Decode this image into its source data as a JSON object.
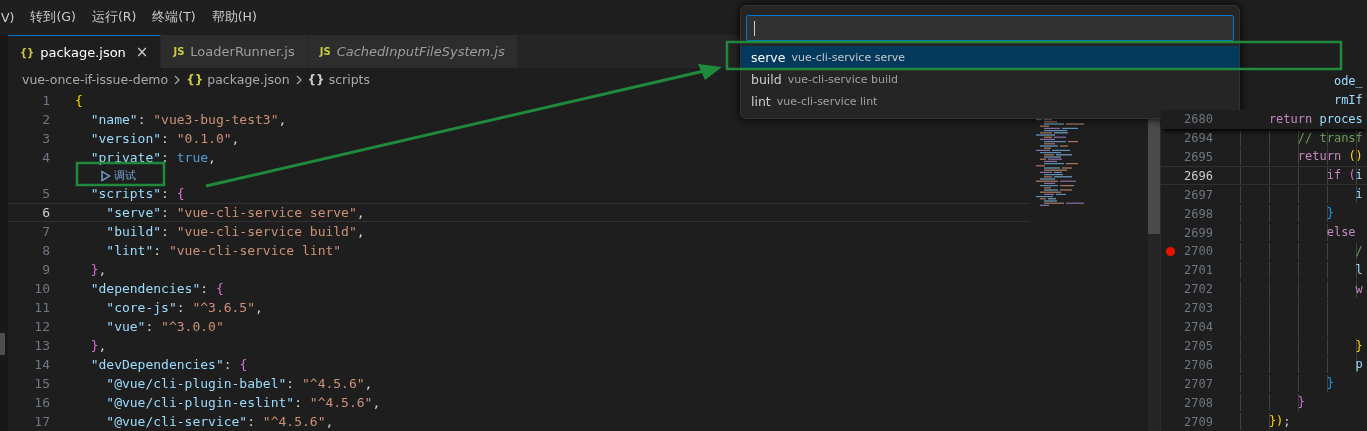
{
  "menu": [
    "V)",
    "转到(G)",
    "运行(R)",
    "终端(T)",
    "帮助(H)"
  ],
  "tabs": [
    {
      "icon": "{}",
      "label": "package.json",
      "selected": true,
      "preview": false,
      "close": "×"
    },
    {
      "icon": "JS",
      "label": "LoaderRunner.js",
      "selected": false,
      "preview": false
    },
    {
      "icon": "JS",
      "label": "CachedInputFileSystem.js",
      "selected": false,
      "preview": true
    }
  ],
  "breadcrumbs": [
    {
      "kind": "folder",
      "text": "vue-once-if-issue-demo"
    },
    {
      "kind": "file",
      "icon": "{}",
      "text": "package.json"
    },
    {
      "kind": "symbol",
      "icon": "{}",
      "text": "scripts"
    }
  ],
  "editor": {
    "lines": [
      {
        "kind": "code",
        "number": "1",
        "current": false,
        "tokens": [
          {
            "kind": "b1",
            "text": "{"
          }
        ]
      },
      {
        "kind": "code",
        "number": "2",
        "current": false,
        "tokens": [
          {
            "kind": "key",
            "text": "  \"name\""
          },
          {
            "kind": "p",
            "text": ": "
          },
          {
            "kind": "str",
            "text": "\"vue3-bug-test3\""
          },
          {
            "kind": "p",
            "text": ","
          }
        ]
      },
      {
        "kind": "code",
        "number": "3",
        "current": false,
        "tokens": [
          {
            "kind": "key",
            "text": "  \"version\""
          },
          {
            "kind": "p",
            "text": ": "
          },
          {
            "kind": "str",
            "text": "\"0.1.0\""
          },
          {
            "kind": "p",
            "text": ","
          }
        ]
      },
      {
        "kind": "code",
        "number": "4",
        "current": false,
        "tokens": [
          {
            "kind": "key",
            "text": "  \"private\""
          },
          {
            "kind": "p",
            "text": ": "
          },
          {
            "kind": "kw",
            "text": "true"
          },
          {
            "kind": "p",
            "text": ","
          }
        ]
      },
      {
        "kind": "codelens",
        "text": "调试"
      },
      {
        "kind": "code",
        "number": "5",
        "current": false,
        "tokens": [
          {
            "kind": "key",
            "text": "  \"scripts\""
          },
          {
            "kind": "p",
            "text": ": "
          },
          {
            "kind": "b2",
            "text": "{"
          }
        ]
      },
      {
        "kind": "code",
        "number": "6",
        "current": true,
        "tokens": [
          {
            "kind": "key",
            "text": "    \"serve\""
          },
          {
            "kind": "p",
            "text": ": "
          },
          {
            "kind": "str",
            "text": "\"vue-cli-service serve\""
          },
          {
            "kind": "p",
            "text": ","
          }
        ]
      },
      {
        "kind": "code",
        "number": "7",
        "current": false,
        "tokens": [
          {
            "kind": "key",
            "text": "    \"build\""
          },
          {
            "kind": "p",
            "text": ": "
          },
          {
            "kind": "str",
            "text": "\"vue-cli-service build\""
          },
          {
            "kind": "p",
            "text": ","
          }
        ]
      },
      {
        "kind": "code",
        "number": "8",
        "current": false,
        "tokens": [
          {
            "kind": "key",
            "text": "    \"lint\""
          },
          {
            "kind": "p",
            "text": ": "
          },
          {
            "kind": "str",
            "text": "\"vue-cli-service lint\""
          }
        ]
      },
      {
        "kind": "code",
        "number": "9",
        "current": false,
        "tokens": [
          {
            "kind": "b2",
            "text": "  }"
          },
          {
            "kind": "p",
            "text": ","
          }
        ]
      },
      {
        "kind": "code",
        "number": "10",
        "current": false,
        "tokens": [
          {
            "kind": "key",
            "text": "  \"dependencies\""
          },
          {
            "kind": "p",
            "text": ": "
          },
          {
            "kind": "b2",
            "text": "{"
          }
        ]
      },
      {
        "kind": "code",
        "number": "11",
        "current": false,
        "tokens": [
          {
            "kind": "key",
            "text": "    \"core-js\""
          },
          {
            "kind": "p",
            "text": ": "
          },
          {
            "kind": "str",
            "text": "\"^3.6.5\""
          },
          {
            "kind": "p",
            "text": ","
          }
        ]
      },
      {
        "kind": "code",
        "number": "12",
        "current": false,
        "tokens": [
          {
            "kind": "key",
            "text": "    \"vue\""
          },
          {
            "kind": "p",
            "text": ": "
          },
          {
            "kind": "str",
            "text": "\"^3.0.0\""
          }
        ]
      },
      {
        "kind": "code",
        "number": "13",
        "current": false,
        "tokens": [
          {
            "kind": "b2",
            "text": "  }"
          },
          {
            "kind": "p",
            "text": ","
          }
        ]
      },
      {
        "kind": "code",
        "number": "14",
        "current": false,
        "tokens": [
          {
            "kind": "key",
            "text": "  \"devDependencies\""
          },
          {
            "kind": "p",
            "text": ": "
          },
          {
            "kind": "b2",
            "text": "{"
          }
        ]
      },
      {
        "kind": "code",
        "number": "15",
        "current": false,
        "tokens": [
          {
            "kind": "key",
            "text": "    \"@vue/cli-plugin-babel\""
          },
          {
            "kind": "p",
            "text": ": "
          },
          {
            "kind": "str",
            "text": "\"^4.5.6\""
          },
          {
            "kind": "p",
            "text": ","
          }
        ]
      },
      {
        "kind": "code",
        "number": "16",
        "current": false,
        "tokens": [
          {
            "kind": "key",
            "text": "    \"@vue/cli-plugin-eslint\""
          },
          {
            "kind": "p",
            "text": ": "
          },
          {
            "kind": "str",
            "text": "\"^4.5.6\""
          },
          {
            "kind": "p",
            "text": ","
          }
        ]
      },
      {
        "kind": "code",
        "number": "17",
        "current": false,
        "tokens": [
          {
            "kind": "key",
            "text": "    \"@vue/cli-service\""
          },
          {
            "kind": "p",
            "text": ": "
          },
          {
            "kind": "str",
            "text": "\"^4.5.6\""
          },
          {
            "kind": "p",
            "text": ","
          }
        ]
      }
    ]
  },
  "side_editor": {
    "lines": [
      {
        "sticky": true,
        "current": false,
        "tokens": [
          {
            "kind": "ident",
            "text": "             ode_"
          }
        ]
      },
      {
        "sticky": true,
        "current": false,
        "tokens": [
          {
            "kind": "ident",
            "text": "             rmIf"
          }
        ]
      },
      {
        "number": "2680",
        "sticky": true,
        "current": false,
        "breakpoint": false,
        "tokens": [
          {
            "kind": "ctl",
            "text": "    return"
          },
          {
            "kind": "ident",
            "text": " proces"
          }
        ]
      },
      {
        "number": "2694",
        "sticky": false,
        "current": false,
        "breakpoint": false,
        "tokens": [
          {
            "kind": "comment",
            "text": "        // transf"
          }
        ]
      },
      {
        "number": "2695",
        "sticky": false,
        "current": false,
        "breakpoint": false,
        "tokens": [
          {
            "kind": "ctl",
            "text": "        return"
          },
          {
            "kind": "b1",
            "text": " ()"
          }
        ]
      },
      {
        "number": "2696",
        "sticky": false,
        "current": true,
        "breakpoint": false,
        "tokens": [
          {
            "kind": "ctl",
            "text": "            if"
          },
          {
            "kind": "b2",
            "text": " ("
          },
          {
            "kind": "ident",
            "text": "i"
          }
        ]
      },
      {
        "number": "2697",
        "sticky": false,
        "current": false,
        "breakpoint": false,
        "tokens": [
          {
            "kind": "ident",
            "text": "                i"
          }
        ]
      },
      {
        "number": "2698",
        "sticky": false,
        "current": false,
        "breakpoint": false,
        "tokens": [
          {
            "kind": "b3",
            "text": "            }"
          }
        ]
      },
      {
        "number": "2699",
        "sticky": false,
        "current": false,
        "breakpoint": false,
        "tokens": [
          {
            "kind": "ctl",
            "text": "            else"
          }
        ]
      },
      {
        "number": "2700",
        "sticky": false,
        "current": false,
        "breakpoint": true,
        "tokens": [
          {
            "kind": "comment",
            "text": "                /"
          }
        ]
      },
      {
        "number": "2701",
        "sticky": false,
        "current": false,
        "breakpoint": false,
        "tokens": [
          {
            "kind": "ident",
            "text": "                l"
          }
        ]
      },
      {
        "number": "2702",
        "sticky": false,
        "current": false,
        "breakpoint": false,
        "tokens": [
          {
            "kind": "ctl",
            "text": "                w"
          }
        ]
      },
      {
        "number": "2703",
        "sticky": false,
        "current": false,
        "breakpoint": false
      },
      {
        "number": "2704",
        "sticky": false,
        "current": false,
        "breakpoint": false
      },
      {
        "number": "2705",
        "sticky": false,
        "current": false,
        "breakpoint": false,
        "tokens": [
          {
            "kind": "b1",
            "text": "                }"
          }
        ]
      },
      {
        "number": "2706",
        "sticky": false,
        "current": false,
        "breakpoint": false,
        "tokens": [
          {
            "kind": "ident",
            "text": "                p"
          }
        ]
      },
      {
        "number": "2707",
        "sticky": false,
        "current": false,
        "breakpoint": false,
        "tokens": [
          {
            "kind": "b3",
            "text": "            }"
          }
        ]
      },
      {
        "number": "2708",
        "sticky": false,
        "current": false,
        "breakpoint": false,
        "tokens": [
          {
            "kind": "b2",
            "text": "        }"
          }
        ]
      },
      {
        "number": "2709",
        "sticky": false,
        "current": false,
        "breakpoint": false,
        "tokens": [
          {
            "kind": "b1",
            "text": "    })"
          },
          {
            "kind": "p",
            "text": ";"
          }
        ]
      }
    ]
  },
  "quick_pick": {
    "items": [
      {
        "label": "serve",
        "description": "vue-cli-service serve",
        "selected": true
      },
      {
        "label": "build",
        "description": "vue-cli-service build",
        "selected": false
      },
      {
        "label": "lint",
        "description": "vue-cli-service lint",
        "selected": false
      }
    ]
  }
}
